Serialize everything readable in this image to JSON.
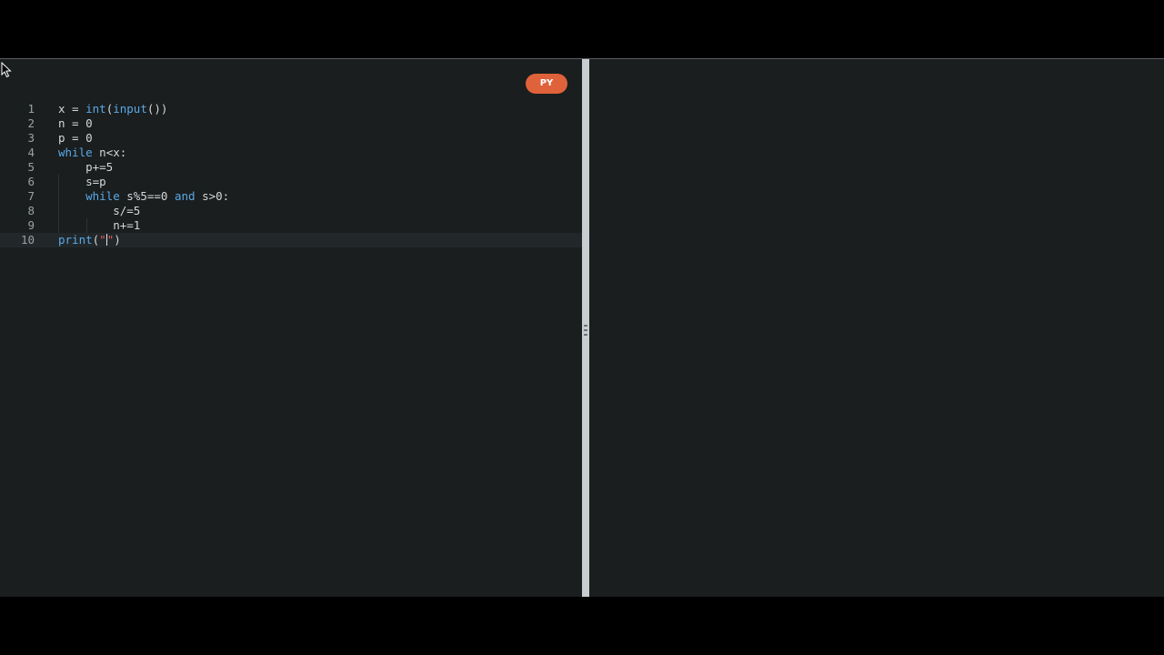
{
  "editor": {
    "language_badge": "PY",
    "active_line": 10,
    "lines": [
      {
        "number": "1",
        "tokens": [
          {
            "t": "x = "
          },
          {
            "t": "int",
            "c": "fn"
          },
          {
            "t": "("
          },
          {
            "t": "input",
            "c": "fn"
          },
          {
            "t": "())"
          }
        ]
      },
      {
        "number": "2",
        "tokens": [
          {
            "t": "n = 0"
          }
        ]
      },
      {
        "number": "3",
        "tokens": [
          {
            "t": "p = 0"
          }
        ]
      },
      {
        "number": "4",
        "tokens": [
          {
            "t": "while",
            "c": "kw"
          },
          {
            "t": " n<x:"
          }
        ]
      },
      {
        "number": "5",
        "tokens": [
          {
            "t": "    p+=5"
          }
        ]
      },
      {
        "number": "6",
        "tokens": [
          {
            "t": "    s=p"
          }
        ]
      },
      {
        "number": "7",
        "tokens": [
          {
            "t": "    "
          },
          {
            "t": "while",
            "c": "kw"
          },
          {
            "t": " s%5==0 "
          },
          {
            "t": "and",
            "c": "kw"
          },
          {
            "t": " s>0:"
          }
        ]
      },
      {
        "number": "8",
        "tokens": [
          {
            "t": "        s/=5"
          }
        ]
      },
      {
        "number": "9",
        "tokens": [
          {
            "t": "        n+=1"
          }
        ]
      },
      {
        "number": "10",
        "tokens": [
          {
            "t": "print",
            "c": "fn"
          },
          {
            "t": "("
          },
          {
            "t": "\"",
            "c": "str"
          },
          {
            "caret": true
          },
          {
            "t": "\"",
            "c": "str"
          },
          {
            "t": ")"
          }
        ]
      }
    ]
  },
  "output": {
    "text": ""
  },
  "colors": {
    "background": "#1a1e1f",
    "badge": "#e0623a",
    "keyword": "#5aa9e6",
    "string": "#e45f5f",
    "divider": "#c7cdd1"
  },
  "icons": {
    "mouse_cursor": "mouse-pointer-icon",
    "divider_grip": "drag-handle-icon"
  }
}
